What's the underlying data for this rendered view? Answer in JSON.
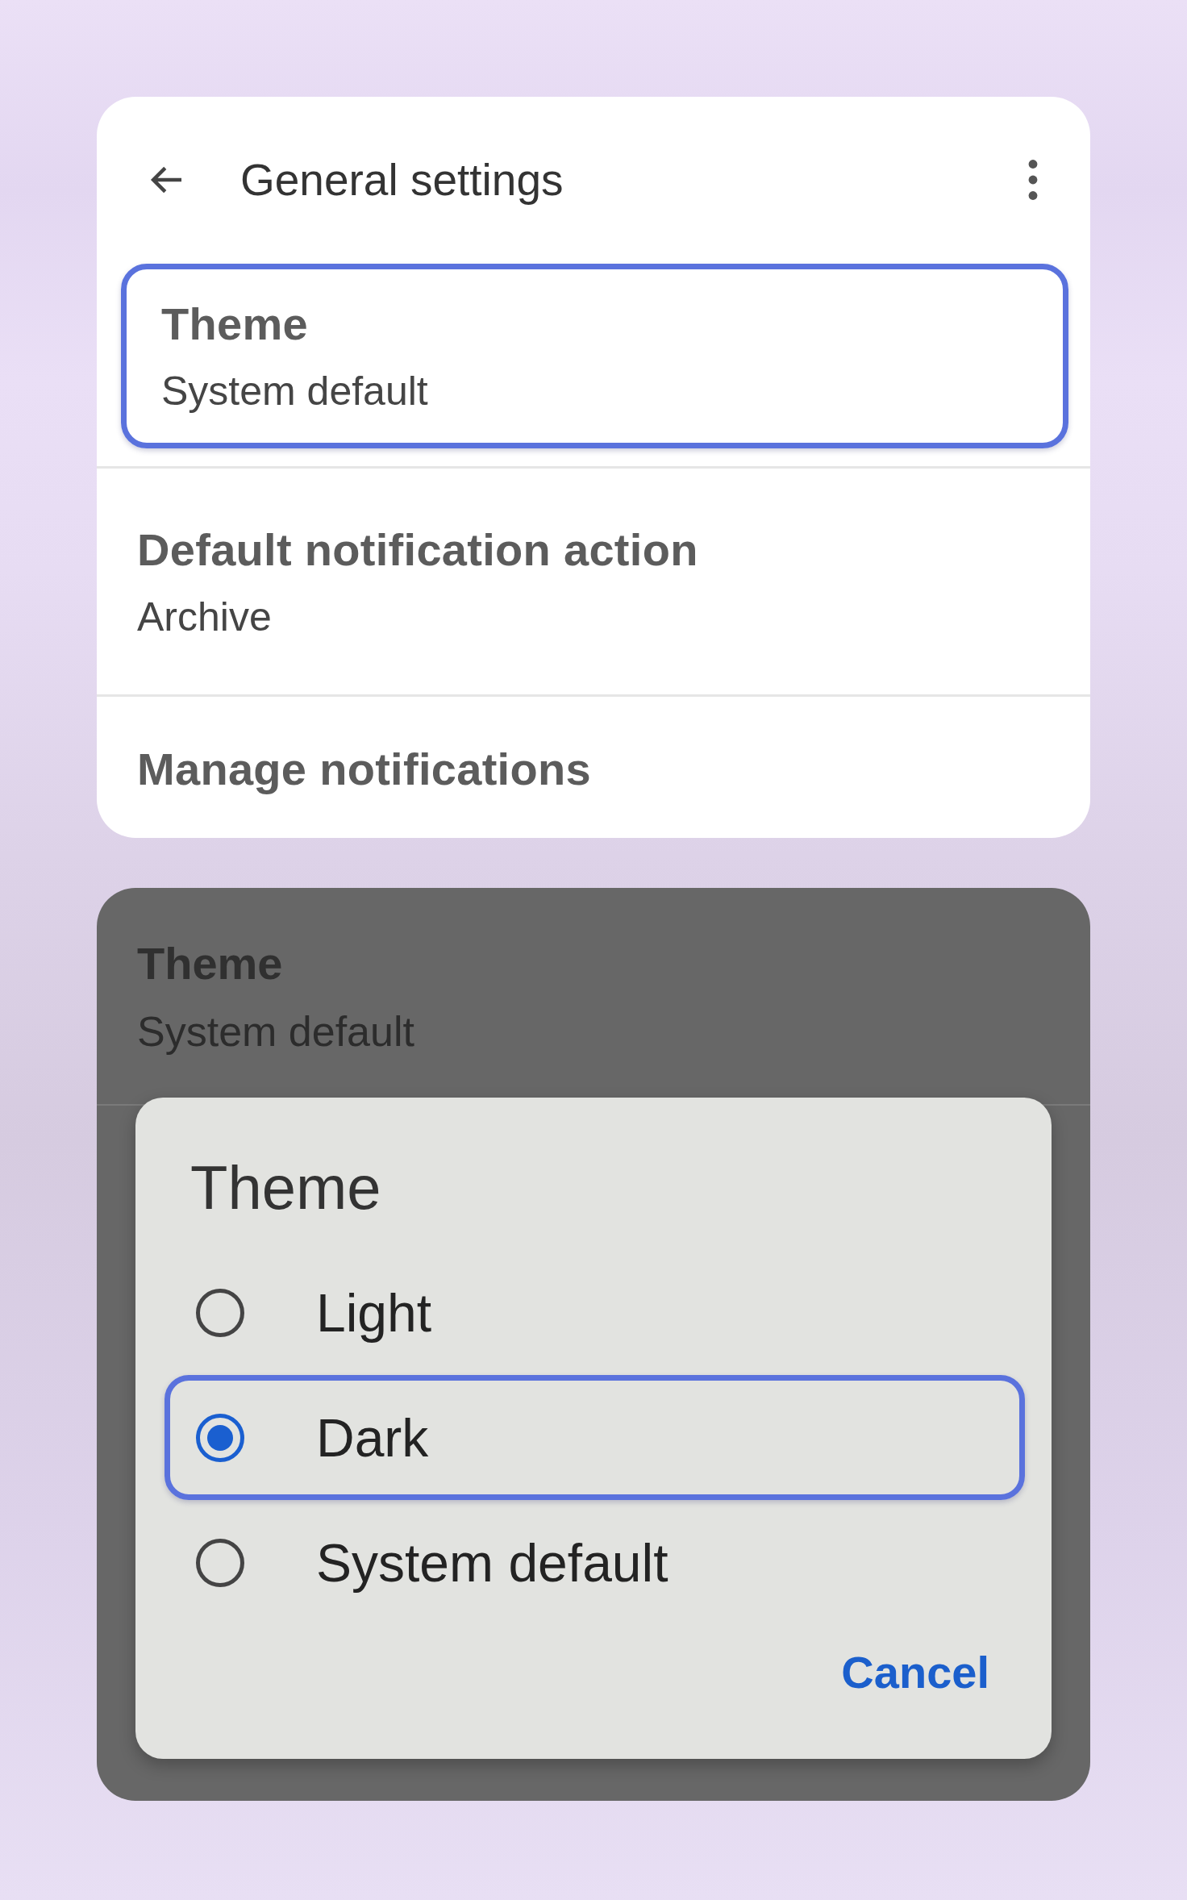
{
  "header": {
    "title": "General settings"
  },
  "settings": [
    {
      "title": "Theme",
      "value": "System default",
      "highlighted": true
    },
    {
      "title": "Default notification action",
      "value": "Archive",
      "highlighted": false
    },
    {
      "title": "Manage notifications",
      "highlighted": false
    }
  ],
  "background_list": [
    {
      "title": "Theme",
      "value": "System default"
    }
  ],
  "dialog": {
    "title": "Theme",
    "options": [
      {
        "label": "Light",
        "selected": false,
        "highlighted": false
      },
      {
        "label": "Dark",
        "selected": true,
        "highlighted": true
      },
      {
        "label": "System default",
        "selected": false,
        "highlighted": false
      }
    ],
    "cancel": "Cancel"
  }
}
